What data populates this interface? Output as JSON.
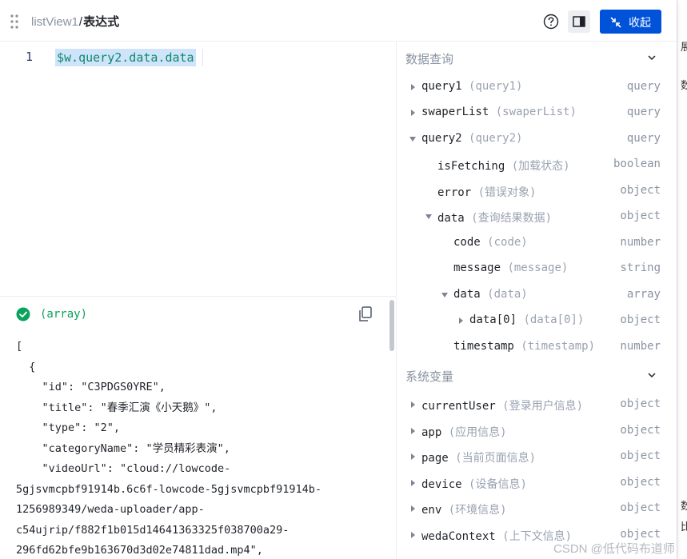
{
  "header": {
    "breadcrumb_parent": "listView1",
    "breadcrumb_sep": "/",
    "breadcrumb_current": "表达式",
    "collapse_label": "收起"
  },
  "editor": {
    "line_number": "1",
    "code": "$w.query2.data.data"
  },
  "result": {
    "type_label": "(array)",
    "json_text": "[\n  {\n    \"id\": \"C3PDGS0YRE\",\n    \"title\": \"春季汇演《小天鹅》\",\n    \"type\": \"2\",\n    \"categoryName\": \"学员精彩表演\",\n    \"videoUrl\": \"cloud://lowcode-\n5gjsvmcpbf91914b.6c6f-lowcode-5gjsvmcpbf91914b-\n1256989349/weda-uploader/app-\nc54ujrip/f882f1b015d14641363325f038700a29-\n296fd62bfe9b163670d3d02e74811dad.mp4\","
  },
  "tree": {
    "sections": [
      {
        "title": "数据查询"
      },
      {
        "title": "系统变量"
      }
    ],
    "query_rows": [
      {
        "name": "query1",
        "desc": "(query1)",
        "type": "query",
        "arrow": "right",
        "indent": 0
      },
      {
        "name": "swaperList",
        "desc": "(swaperList)",
        "type": "query",
        "arrow": "right",
        "indent": 0
      },
      {
        "name": "query2",
        "desc": "(query2)",
        "type": "query",
        "arrow": "down",
        "indent": 0
      },
      {
        "name": "isFetching",
        "desc": "(加载状态)",
        "type": "boolean",
        "arrow": "none",
        "indent": 1
      },
      {
        "name": "error",
        "desc": "(错误对象)",
        "type": "object",
        "arrow": "none",
        "indent": 1
      },
      {
        "name": "data",
        "desc": "(查询结果数据)",
        "type": "object",
        "arrow": "down",
        "indent": 1
      },
      {
        "name": "code",
        "desc": "(code)",
        "type": "number",
        "arrow": "none",
        "indent": 2
      },
      {
        "name": "message",
        "desc": "(message)",
        "type": "string",
        "arrow": "none",
        "indent": 2
      },
      {
        "name": "data",
        "desc": "(data)",
        "type": "array",
        "arrow": "down",
        "indent": 2
      },
      {
        "name": "data[0]",
        "desc": "(data[0])",
        "type": "object",
        "arrow": "right",
        "indent": 3
      },
      {
        "name": "timestamp",
        "desc": "(timestamp)",
        "type": "number",
        "arrow": "none",
        "indent": 2
      }
    ],
    "system_rows": [
      {
        "name": "currentUser",
        "desc": "(登录用户信息)",
        "type": "object",
        "arrow": "right",
        "indent": 0
      },
      {
        "name": "app",
        "desc": "(应用信息)",
        "type": "object",
        "arrow": "right",
        "indent": 0
      },
      {
        "name": "page",
        "desc": "(当前页面信息)",
        "type": "object",
        "arrow": "right",
        "indent": 0
      },
      {
        "name": "device",
        "desc": "(设备信息)",
        "type": "object",
        "arrow": "right",
        "indent": 0
      },
      {
        "name": "env",
        "desc": "(环境信息)",
        "type": "object",
        "arrow": "right",
        "indent": 0
      },
      {
        "name": "wedaContext",
        "desc": "(上下文信息)",
        "type": "object",
        "arrow": "right",
        "indent": 0
      }
    ]
  },
  "backdrop": {
    "fragments": [
      "展",
      "数",
      "数",
      "比"
    ]
  },
  "watermark": "CSDN @低代码布道师",
  "colors": {
    "primary": "#0052d9",
    "success": "#0aa35c",
    "code": "#0b8a6b",
    "selection": "#cfe4fb"
  }
}
